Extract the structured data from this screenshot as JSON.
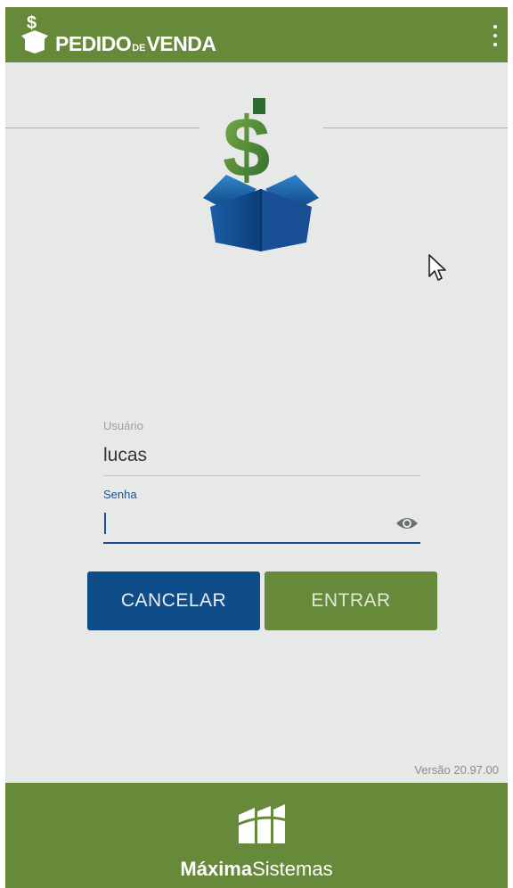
{
  "header": {
    "title_part1": "PEDIDO",
    "title_de": "DE",
    "title_part2": "VENDA"
  },
  "login": {
    "user_label": "Usuário",
    "user_value": "lucas",
    "password_label": "Senha",
    "password_value": ""
  },
  "buttons": {
    "cancel": "CANCELAR",
    "enter": "ENTRAR"
  },
  "version": "Versão 20.97.00",
  "footer": {
    "brand_bold": "Máxima",
    "brand_regular": "Sistemas"
  },
  "colors": {
    "brand_green": "#678a3a",
    "brand_blue": "#0f4c8a",
    "background": "#e7e8e8"
  },
  "icons": [
    "dollar-box-logo-icon",
    "kebab-menu-icon",
    "eye-icon",
    "mouse-cursor-icon",
    "maxima-logo-icon"
  ]
}
